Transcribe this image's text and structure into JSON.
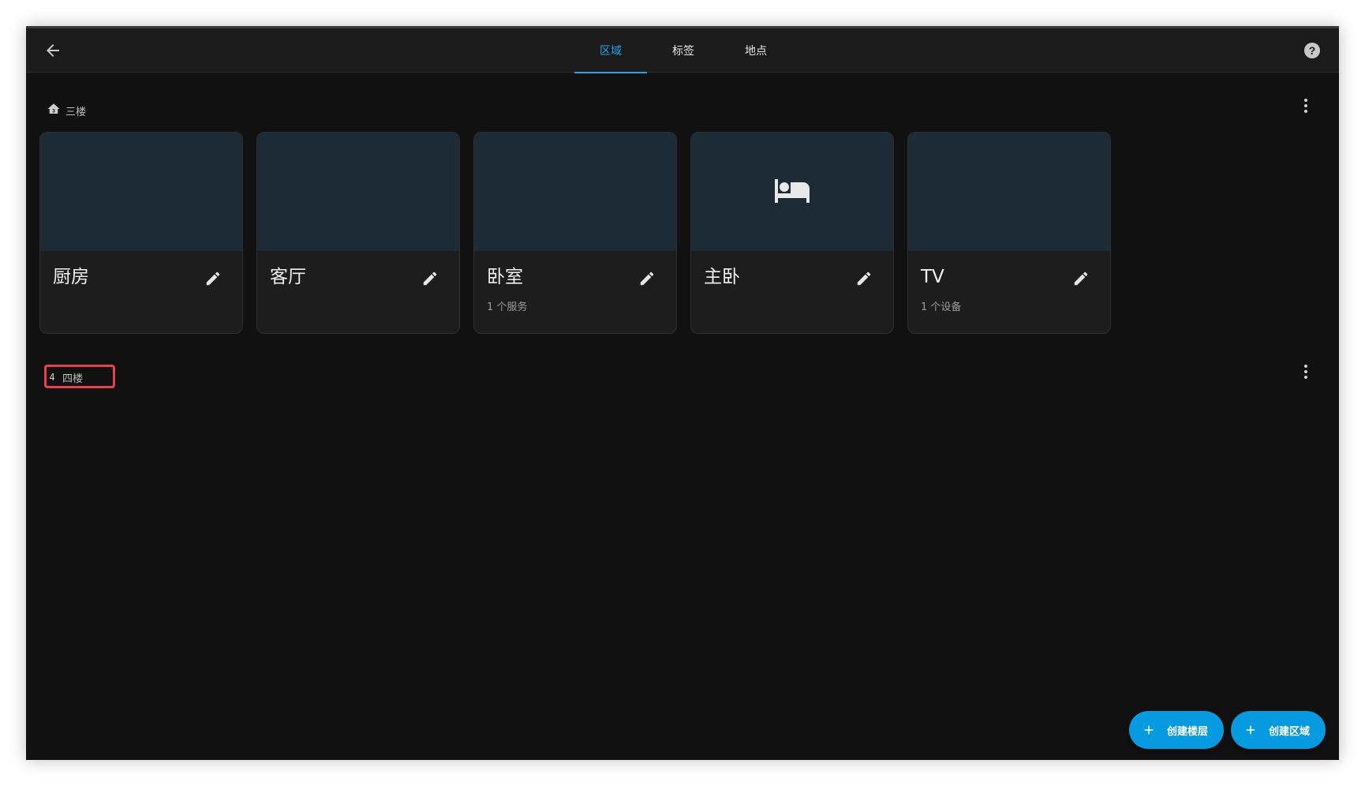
{
  "tabs": [
    {
      "label": "区域",
      "active": true
    },
    {
      "label": "标签",
      "active": false
    },
    {
      "label": "地点",
      "active": false
    }
  ],
  "floors": [
    {
      "label": "三楼",
      "icon": "home-floor-3-icon",
      "areas": [
        {
          "name": "厨房",
          "subtitle": "",
          "icon": ""
        },
        {
          "name": "客厅",
          "subtitle": "",
          "icon": ""
        },
        {
          "name": "卧室",
          "subtitle": "1 个服务",
          "icon": ""
        },
        {
          "name": "主卧",
          "subtitle": "",
          "icon": "bed-icon"
        },
        {
          "name": "TV",
          "subtitle": "1 个设备",
          "icon": ""
        }
      ]
    },
    {
      "label": "四楼",
      "icon_text": "4",
      "areas": []
    }
  ],
  "actions": {
    "create_floor": "创建楼层",
    "create_area": "创建区域"
  },
  "colors": {
    "accent": "#1fa5e8",
    "fab": "#069be0",
    "card_image_bg": "#1c2b35",
    "highlight": "#e8404f"
  }
}
